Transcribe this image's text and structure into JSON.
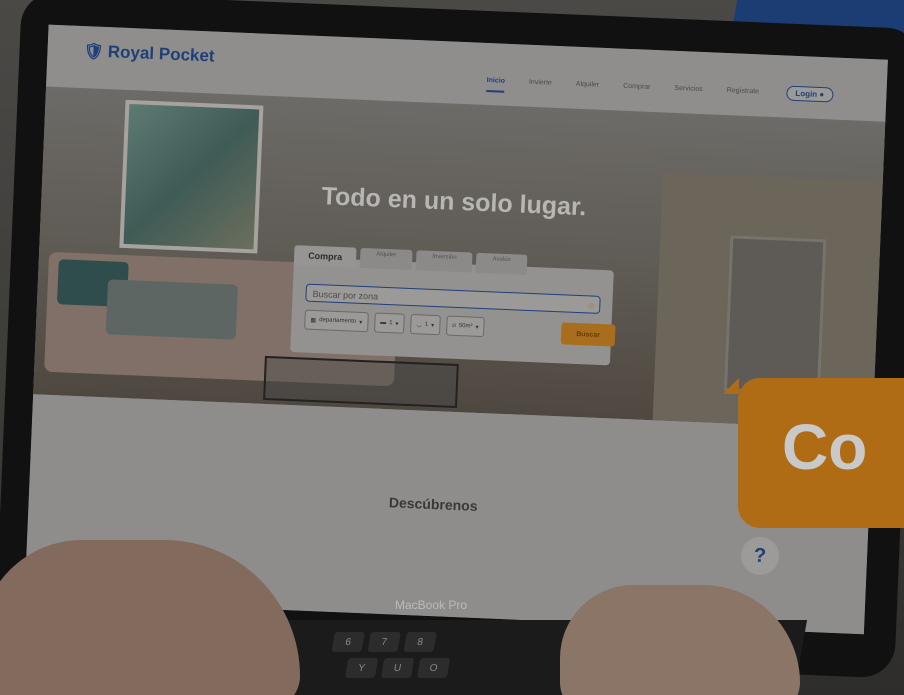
{
  "brand": {
    "logo_text": "Royal Pocket"
  },
  "nav": {
    "items": [
      "Inicio",
      "Invierte",
      "Alquiler",
      "Comprar",
      "Servicios",
      "Regístrate"
    ],
    "active": "Inicio",
    "login_label": "Login"
  },
  "hero": {
    "title": "Todo en un solo lugar."
  },
  "search": {
    "tabs": [
      "Compra",
      "Alquiler",
      "Inversión",
      "Avalúo"
    ],
    "placeholder": "Buscar por zona",
    "filters": [
      "departamento",
      "1",
      "1",
      "50m²"
    ],
    "button_label": "Buscar"
  },
  "section": {
    "title": "Descúbrenos"
  },
  "help_label": "?",
  "laptop_label": "MacBook Pro",
  "promo_text": "Co",
  "keyboard": {
    "keys": [
      "6",
      "7",
      "8",
      "Y",
      "U",
      "O"
    ]
  },
  "colors": {
    "brand_blue": "#1f3f7a",
    "accent_orange": "#b06c14"
  }
}
